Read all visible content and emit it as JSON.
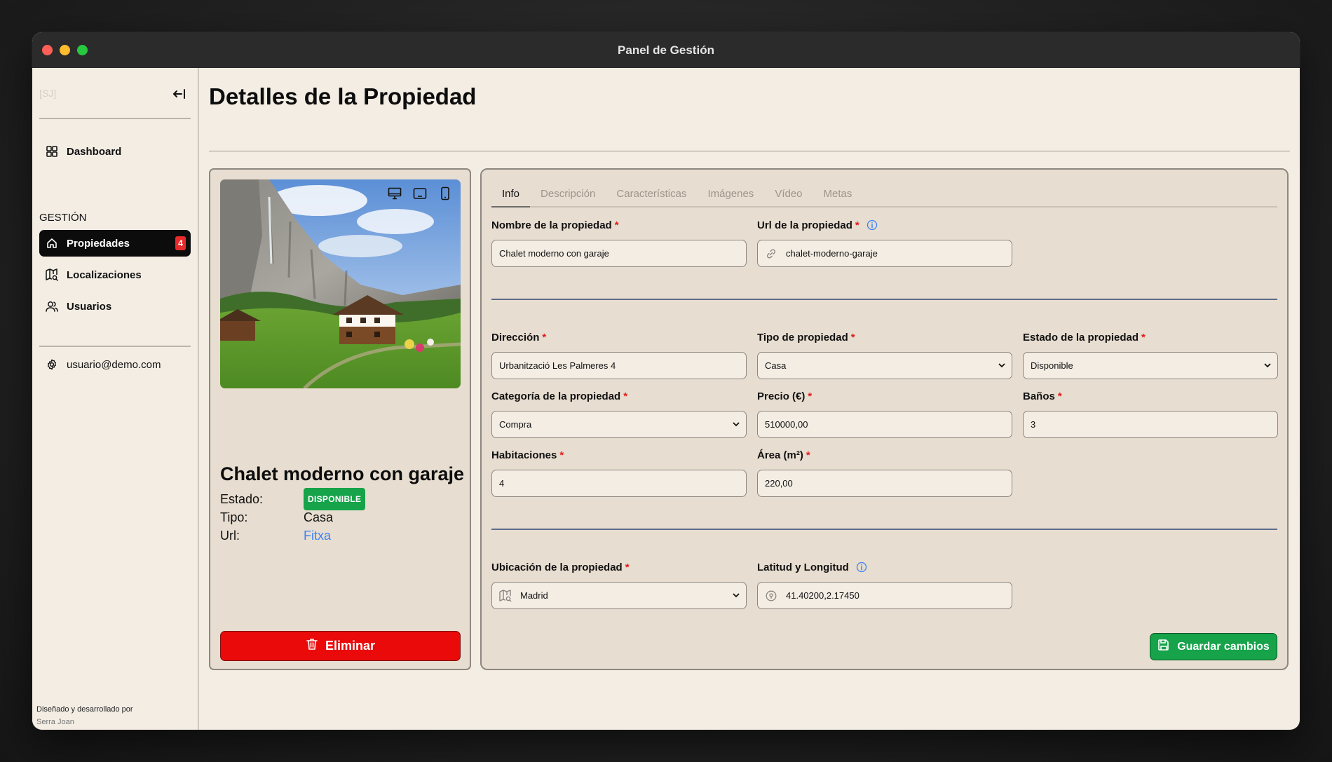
{
  "window": {
    "title": "Panel de Gestión"
  },
  "sidebar": {
    "logo": "[SJ]",
    "section_label": "GESTIÓN",
    "dashboard": "Dashboard",
    "items": [
      {
        "label": "Propiedades",
        "badge": "4",
        "icon": "home-icon",
        "active": true
      },
      {
        "label": "Localizaciones",
        "icon": "map-search-icon"
      },
      {
        "label": "Usuarios",
        "icon": "users-icon"
      }
    ],
    "user_email": "usuario@demo.com",
    "footer_line1": "Diseñado y desarrollado por",
    "footer_author": "Serra Joan"
  },
  "page": {
    "title": "Detalles de la Propiedad"
  },
  "property_card": {
    "name": "Chalet moderno con garaje",
    "estado_label": "Estado:",
    "estado_value": "DISPONIBLE",
    "tipo_label": "Tipo:",
    "tipo_value": "Casa",
    "url_label": "Url:",
    "url_value": "Fitxa",
    "delete_label": "Eliminar"
  },
  "tabs": [
    "Info",
    "Descripción",
    "Características",
    "Imágenes",
    "Vídeo",
    "Metas"
  ],
  "form": {
    "nombre": {
      "label": "Nombre de la propiedad",
      "value": "Chalet moderno con garaje"
    },
    "url": {
      "label": "Url de la propiedad",
      "value": "chalet-moderno-garaje"
    },
    "direccion": {
      "label": "Dirección",
      "value": "Urbanització Les Palmeres 4"
    },
    "tipo": {
      "label": "Tipo de propiedad",
      "value": "Casa"
    },
    "estado": {
      "label": "Estado de la propiedad",
      "value": "Disponible"
    },
    "categoria": {
      "label": "Categoría de la propiedad",
      "value": "Compra"
    },
    "precio": {
      "label": "Precio (€)",
      "value": "510000,00"
    },
    "banos": {
      "label": "Baños",
      "value": "3"
    },
    "habitaciones": {
      "label": "Habitaciones",
      "value": "4"
    },
    "area": {
      "label": "Área (m²)",
      "value": "220,00"
    },
    "ubicacion": {
      "label": "Ubicación de la propiedad",
      "value": "Madrid"
    },
    "latlng": {
      "label": "Latitud y Longitud",
      "value": "41.40200,2.17450"
    },
    "required_mark": "*",
    "save_label": "Guardar cambios"
  },
  "colors": {
    "accent_green": "#16a34a",
    "danger_red": "#ea0a0a",
    "link_blue": "#3b82f6"
  }
}
